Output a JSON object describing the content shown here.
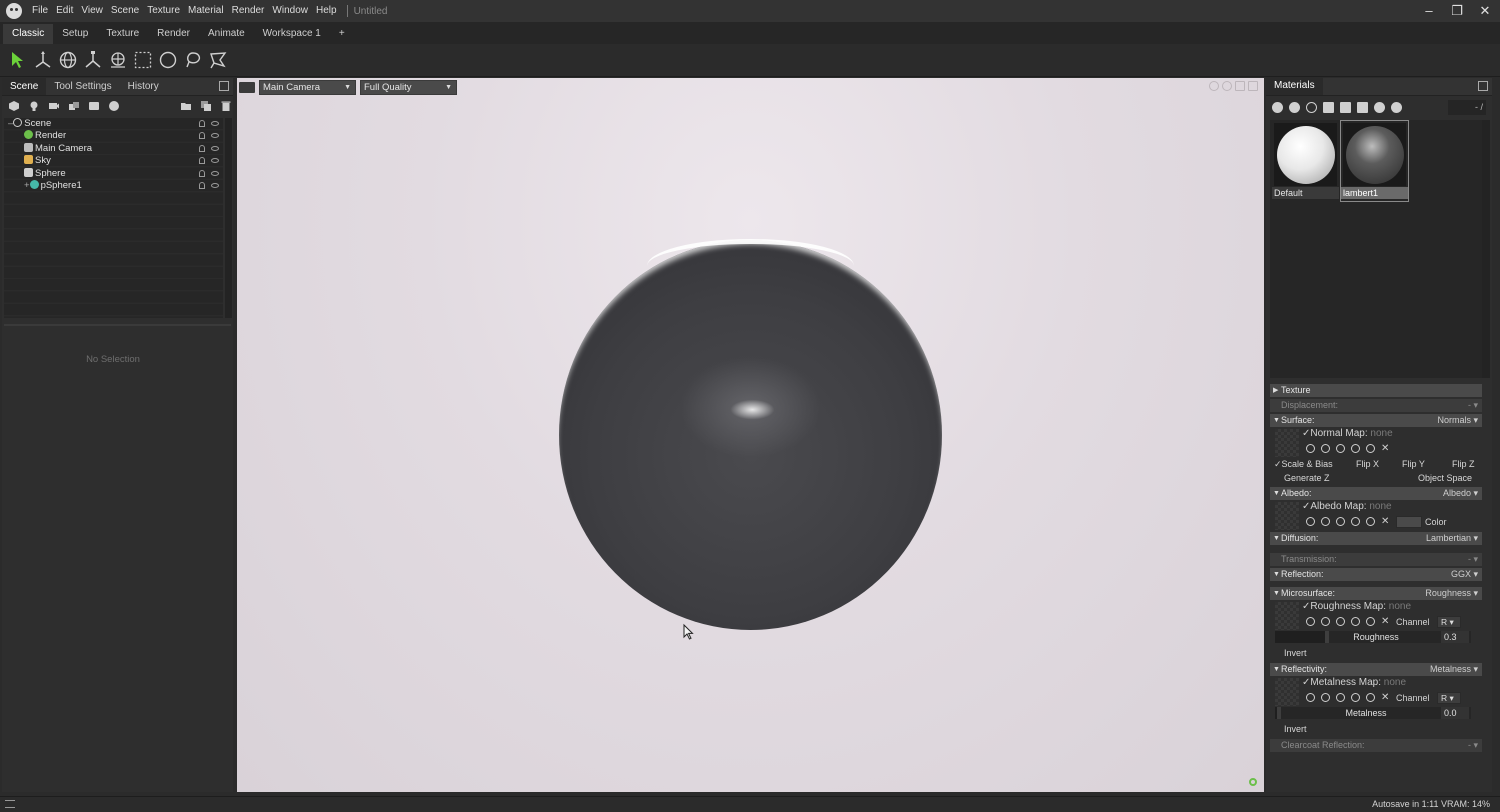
{
  "menu": [
    "File",
    "Edit",
    "View",
    "Scene",
    "Texture",
    "Material",
    "Render",
    "Window",
    "Help"
  ],
  "doc_title": "Untitled",
  "workspace_tabs": [
    "Classic",
    "Setup",
    "Texture",
    "Render",
    "Animate",
    "Workspace 1",
    "+"
  ],
  "left_tabs": [
    "Scene",
    "Tool Settings",
    "History"
  ],
  "scene_tree": [
    {
      "label": "Scene",
      "icon_color": "#cfcfcf"
    },
    {
      "label": "Render",
      "icon_color": "#6cbf4a"
    },
    {
      "label": "Main Camera",
      "icon_color": "#bdbdbd"
    },
    {
      "label": "Sky",
      "icon_color": "#e0b050"
    },
    {
      "label": "Sphere",
      "icon_color": "#cfcfcf"
    },
    {
      "label": "pSphere1",
      "icon_color": "#46b8a8"
    }
  ],
  "no_selection": "No Selection",
  "viewport": {
    "camera": "Main Camera",
    "quality": "Full Quality"
  },
  "materials_tab": "Materials",
  "mat_filter": "- /",
  "materials": [
    {
      "name": "Default",
      "style": "white"
    },
    {
      "name": "lambert1",
      "style": "dark"
    }
  ],
  "props": {
    "texture": "Texture",
    "displacement": {
      "label": "Displacement:",
      "value": "-"
    },
    "surface": {
      "label": "Surface:",
      "value": "Normals"
    },
    "normal_map": {
      "label": "Normal Map:",
      "value": "none"
    },
    "scale_bias": "Scale & Bias",
    "flip_x": "Flip X",
    "flip_y": "Flip Y",
    "flip_z": "Flip Z",
    "generate_z": "Generate Z",
    "object_space": "Object Space",
    "albedo": {
      "label": "Albedo:",
      "value": "Albedo"
    },
    "albedo_map": {
      "label": "Albedo Map:",
      "value": "none"
    },
    "color": "Color",
    "diffusion": {
      "label": "Diffusion:",
      "value": "Lambertian"
    },
    "transmission": {
      "label": "Transmission:",
      "value": "-"
    },
    "reflection": {
      "label": "Reflection:",
      "value": "GGX"
    },
    "microsurface": {
      "label": "Microsurface:",
      "value": "Roughness"
    },
    "roughness_map": {
      "label": "Roughness Map:",
      "value": "none"
    },
    "channel": "Channel",
    "channel_r": "R",
    "roughness": {
      "label": "Roughness",
      "value": "0.3"
    },
    "invert": "Invert",
    "reflectivity": {
      "label": "Reflectivity:",
      "value": "Metalness"
    },
    "metalness_map": {
      "label": "Metalness Map:",
      "value": "none"
    },
    "metalness": {
      "label": "Metalness",
      "value": "0.0"
    },
    "clearcoat": {
      "label": "Clearcoat Reflection:",
      "value": "-"
    }
  },
  "status": "Autosave in 1:11   VRAM: 14%"
}
